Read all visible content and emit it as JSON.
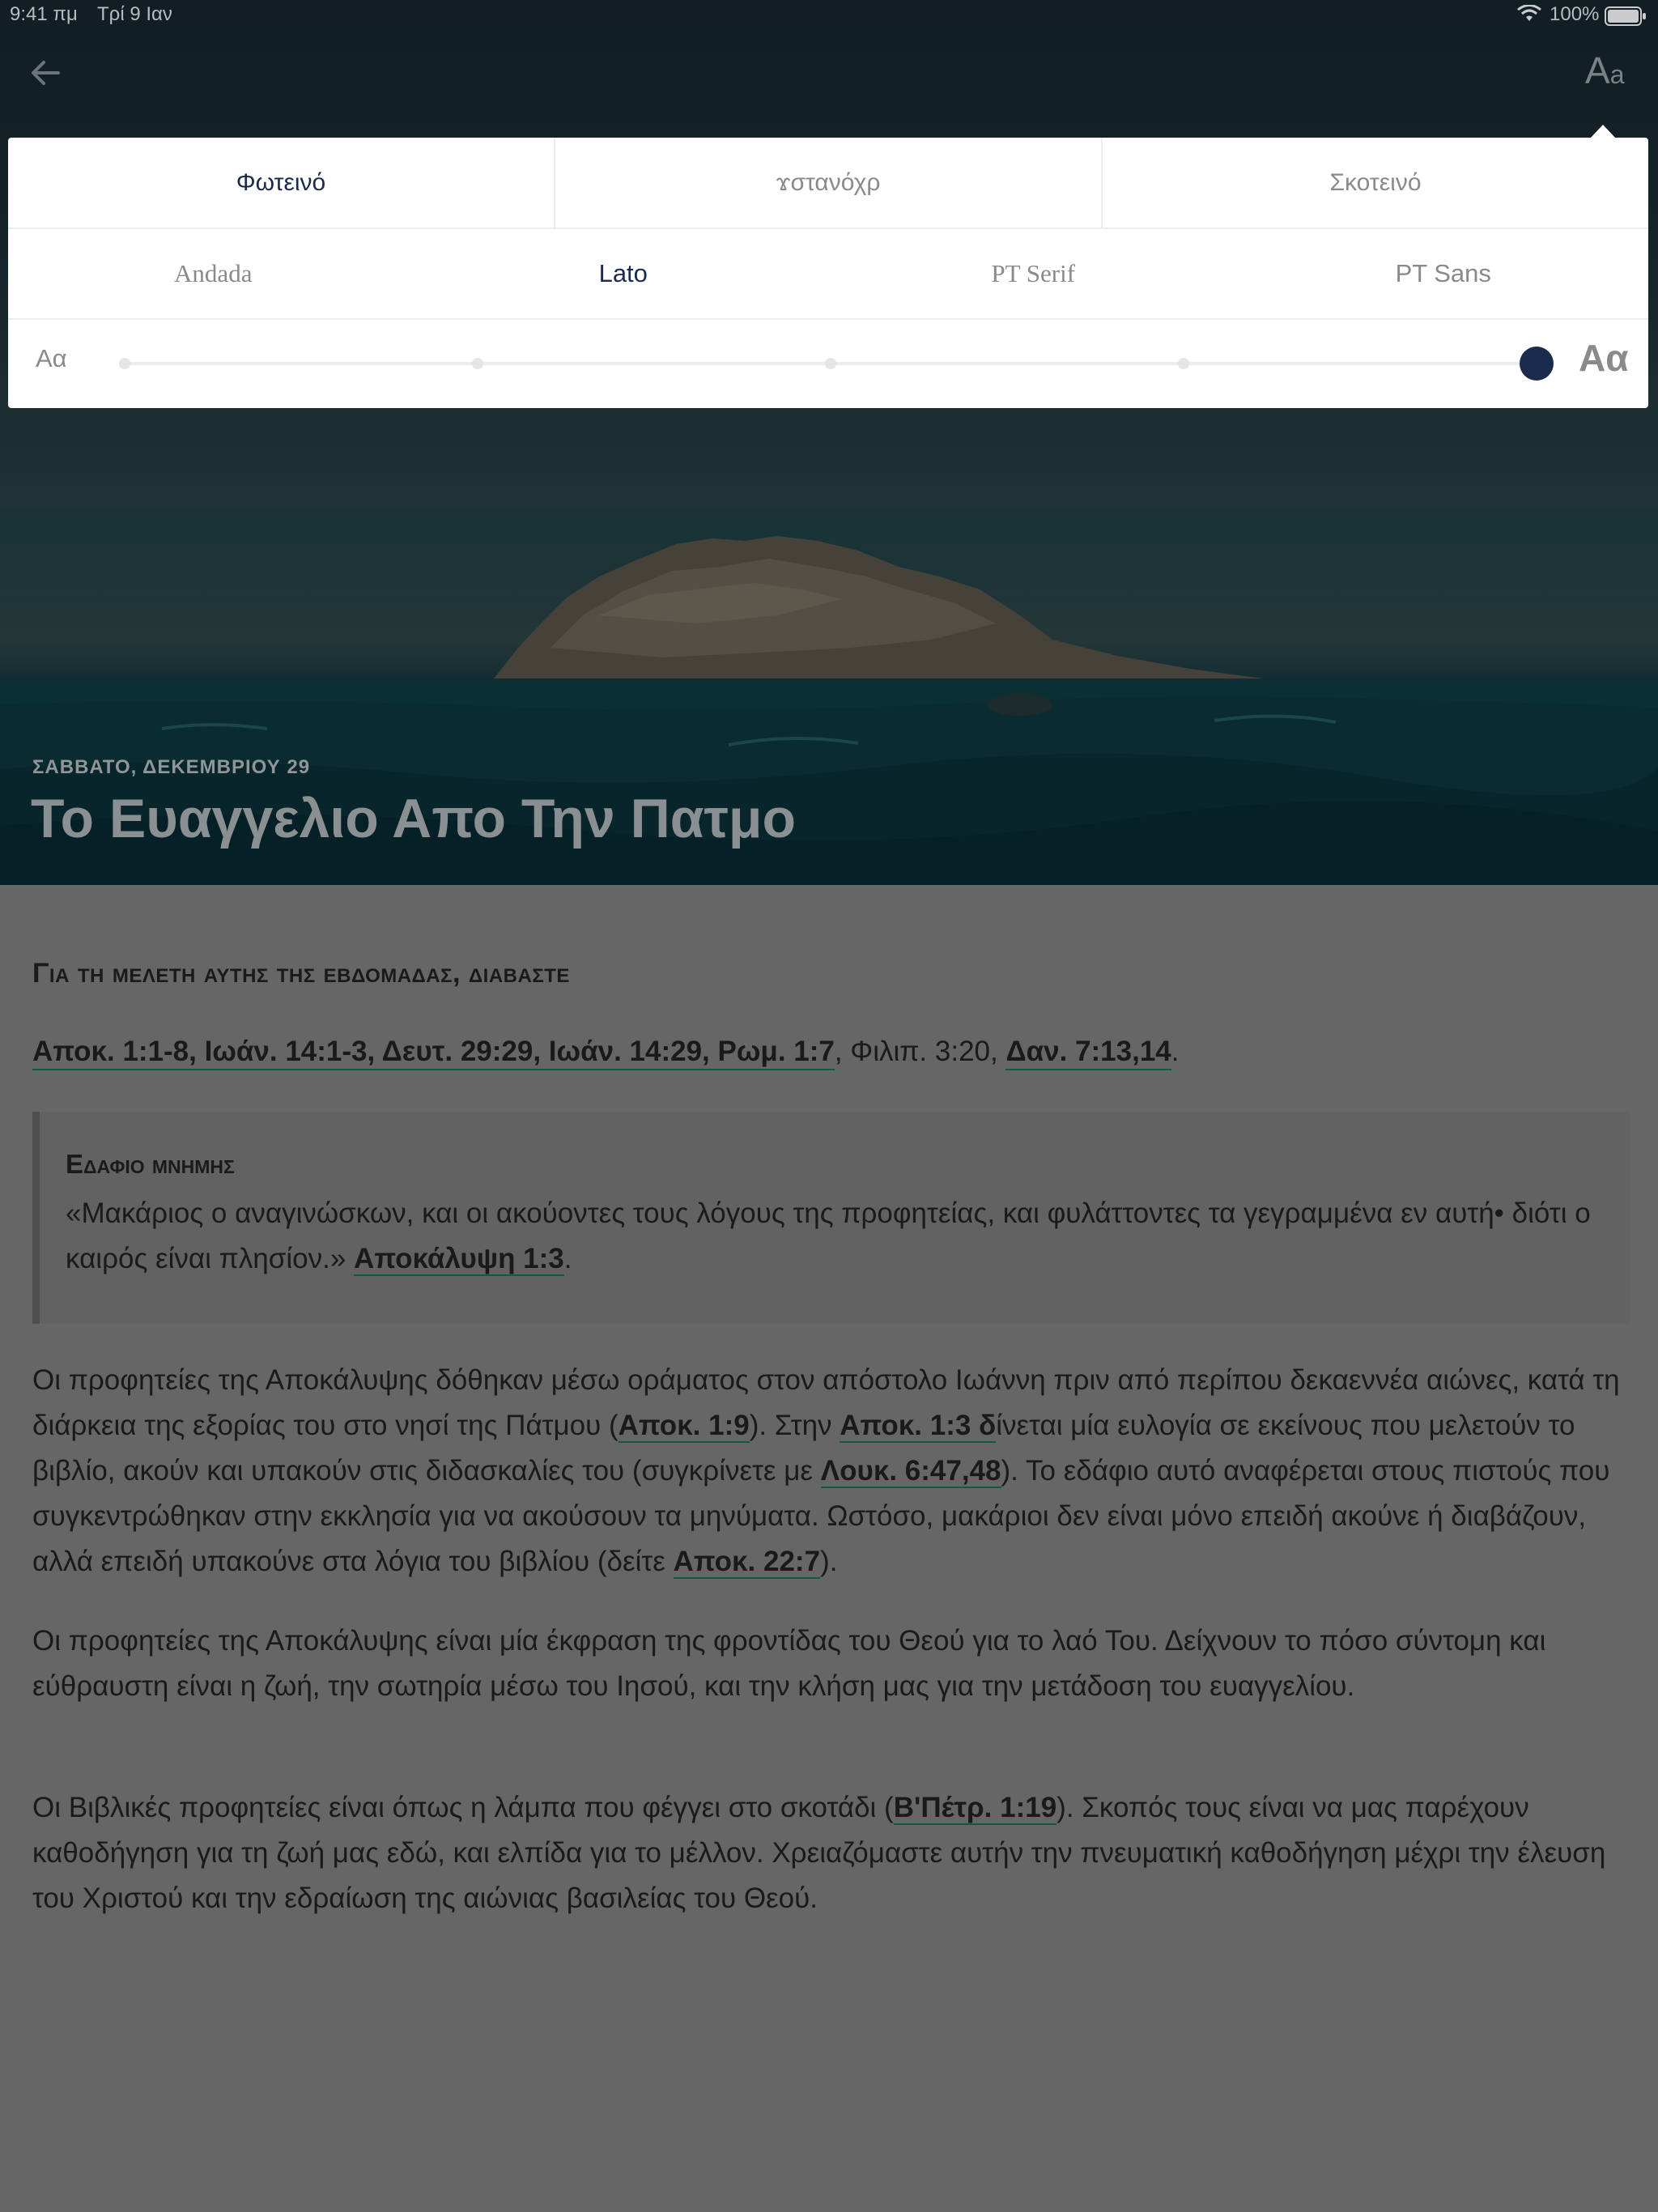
{
  "status_bar": {
    "time": "9:41 πμ",
    "date": "Τρί 9 Ιαν",
    "battery": "100%",
    "wifi_icon": "wifi-icon",
    "battery_icon": "battery-icon"
  },
  "nav": {
    "back_icon": "arrow-left-icon",
    "font_button_big": "A",
    "font_button_small": "a"
  },
  "settings": {
    "themes": [
      "Φωτεινό",
      "ϫστανόχρ",
      "Σκοτεινό"
    ],
    "active_theme": "Φωτεινό",
    "fonts": [
      "Andada",
      "Lato",
      "PT Serif",
      "PT Sans"
    ],
    "active_font": "Lato",
    "size_small_label": "Aα",
    "size_large_label": "Aα",
    "size_steps": 5,
    "size_value": 5
  },
  "hero": {
    "date": "ΣΑΒΒΑΤΟ, ΔΕΚΕΜΒΡΙΟΥ 29",
    "title": "Το Ευαγγελιο Απο Την Πατμο"
  },
  "article": {
    "heading": "Για τη μελετη αυτης της εβδομαδας, διαβαστε",
    "refs_linked": "Αποκ. 1:1-8, Ιωάν. 14:1-3, Δευτ. 29:29, Ιωάν. 14:29, Ρωμ. 1:7",
    "refs_plain": ", Φιλιπ. 3:20, ",
    "refs_linked_2": "Δαν. 7:13,14",
    "refs_end": ".",
    "memory_title": "Εδαφιο μνημης",
    "memory_text": "«Μακάριος ο αναγινώσκων, και οι ακούοντες τους λόγους της προφητείας, και φυλάττοντες τα γεγραμμένα εν αυτή• διότι ο καιρός είναι πλησίον.» ",
    "memory_ref": "Αποκάλυψη 1:3",
    "memory_end": ".",
    "p1_a": "Οι προφητείες της Αποκάλυψης δόθηκαν μέσω οράματος στον απόστολο Ιωάννη πριν από περίπου δεκαεννέα αιώνες, κατά τη διάρκεια της εξορίας του στο νησί της Πάτμου (",
    "p1_ref1": "Αποκ. 1:9",
    "p1_b": "). Στην ",
    "p1_ref2": "Αποκ. 1:3 δ",
    "p1_c": "ίνεται μία ευλογία σε εκείνους που μελετούν το βιβλίο, ακούν και υπακούν στις διδασκαλίες του (συγκρίνετε με ",
    "p1_ref3": "Λουκ. 6:47,48",
    "p1_d": "). Το εδάφιο αυτό αναφέρεται στους πιστούς που συγκεντρώθηκαν στην εκκλησία για να ακούσουν τα μηνύματα. Ωστόσο, μακάριοι δεν είναι μόνο επειδή ακούνε ή διαβάζουν, αλλά επειδή υπακούνε στα λόγια του βιβλίου (δείτε ",
    "p1_ref4": "Αποκ. 22:7",
    "p1_e": ").",
    "p2": "Οι προφητείες της Αποκάλυψης είναι μία έκφραση της φροντίδας του Θεού για το λαό Του. Δείχνουν το πόσο σύντομη και εύθραυστη είναι η ζωή, την σωτηρία μέσω του Ιησού, και την κλήση μας για την μετάδοση του ευαγγελίου.",
    "p3_a": "Οι Βιβλικές προφητείες είναι όπως η λάμπα που φέγγει στο σκοτάδι (",
    "p3_ref": "Β'Πέτρ. 1:19",
    "p3_b": "). Σκοπός τους είναι να μας παρέχουν καθοδήγηση για τη ζωή μας εδώ, και ελπίδα για το μέλλον. Χρειαζόμαστε αυτήν την πνευματική καθοδήγηση μέχρι την έλευση του Χριστού και την εδραίωση της αιώνιας βασιλείας του Θεού."
  },
  "colors": {
    "accent": "#1b2b4e",
    "link_underline": "#0b5a4a",
    "overlay_page": "#666666"
  }
}
